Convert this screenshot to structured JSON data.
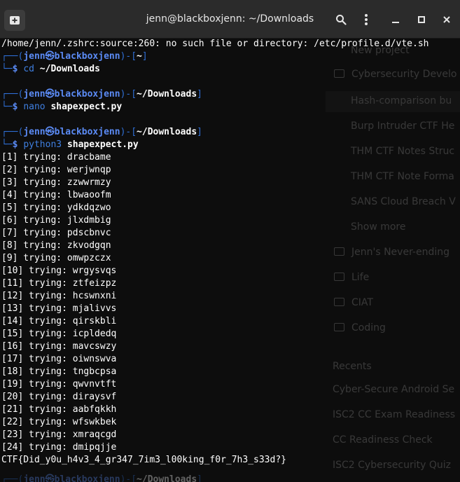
{
  "window": {
    "title": "jenn@blackboxjenn: ~/Downloads"
  },
  "terminal": {
    "error_line": "/home/jenn/.zshrc:source:260: no such file or directory: /etc/profile.d/vte.sh",
    "user": "jenn",
    "host": "blackboxjenn",
    "prompt_symbol": "$",
    "at_symbol": "㉿",
    "prompts": [
      {
        "dir": "~",
        "cmd": "cd",
        "arg": "~/Downloads"
      },
      {
        "dir": "~/Downloads",
        "cmd": "nano",
        "arg": "shapexpect.py"
      },
      {
        "dir": "~/Downloads",
        "cmd": "python3",
        "arg": "shapexpect.py"
      }
    ],
    "output": [
      "[1] trying: dracbame",
      "[2] trying: werjwnqp",
      "[3] trying: zzwwrmzy",
      "[4] trying: lbwaoofm",
      "[5] trying: ydkdqzwo",
      "[6] trying: jlxdmbig",
      "[7] trying: pdscbnvc",
      "[8] trying: zkvodgqn",
      "[9] trying: omwpzczx",
      "[10] trying: wrgysvqs",
      "[11] trying: ztfeizpz",
      "[12] trying: hcswnxni",
      "[13] trying: mjalivvs",
      "[14] trying: qirskbli",
      "[15] trying: icpldedq",
      "[16] trying: mavcswzy",
      "[17] trying: oiwnswva",
      "[18] trying: tngbcpsa",
      "[19] trying: qwvnvtft",
      "[20] trying: diraysvf",
      "[21] trying: aabfqkkh",
      "[22] trying: wfswkbek",
      "[23] trying: xmraqcgd",
      "[24] trying: dmipqjje"
    ],
    "flag": "CTF{Did_y0u_h4v3_4_gr347_7im3_l00king_f0r_7h3_s33d?}"
  },
  "background_panel": {
    "items": [
      "New project",
      "Cybersecurity Develo",
      "Hash-comparison bu",
      "Burp Intruder CTF He",
      "THM CTF Notes Struc",
      "THM CTF Note Forma",
      "SANS Cloud Breach V",
      "Show more",
      "Jenn's Never-ending",
      "Life",
      "CIAT",
      "Coding",
      "Recents",
      "Cyber-Secure Android Se",
      "ISC2 CC Exam Readiness",
      "CC Readiness Check",
      "ISC2 Cybersecurity Quiz"
    ]
  }
}
